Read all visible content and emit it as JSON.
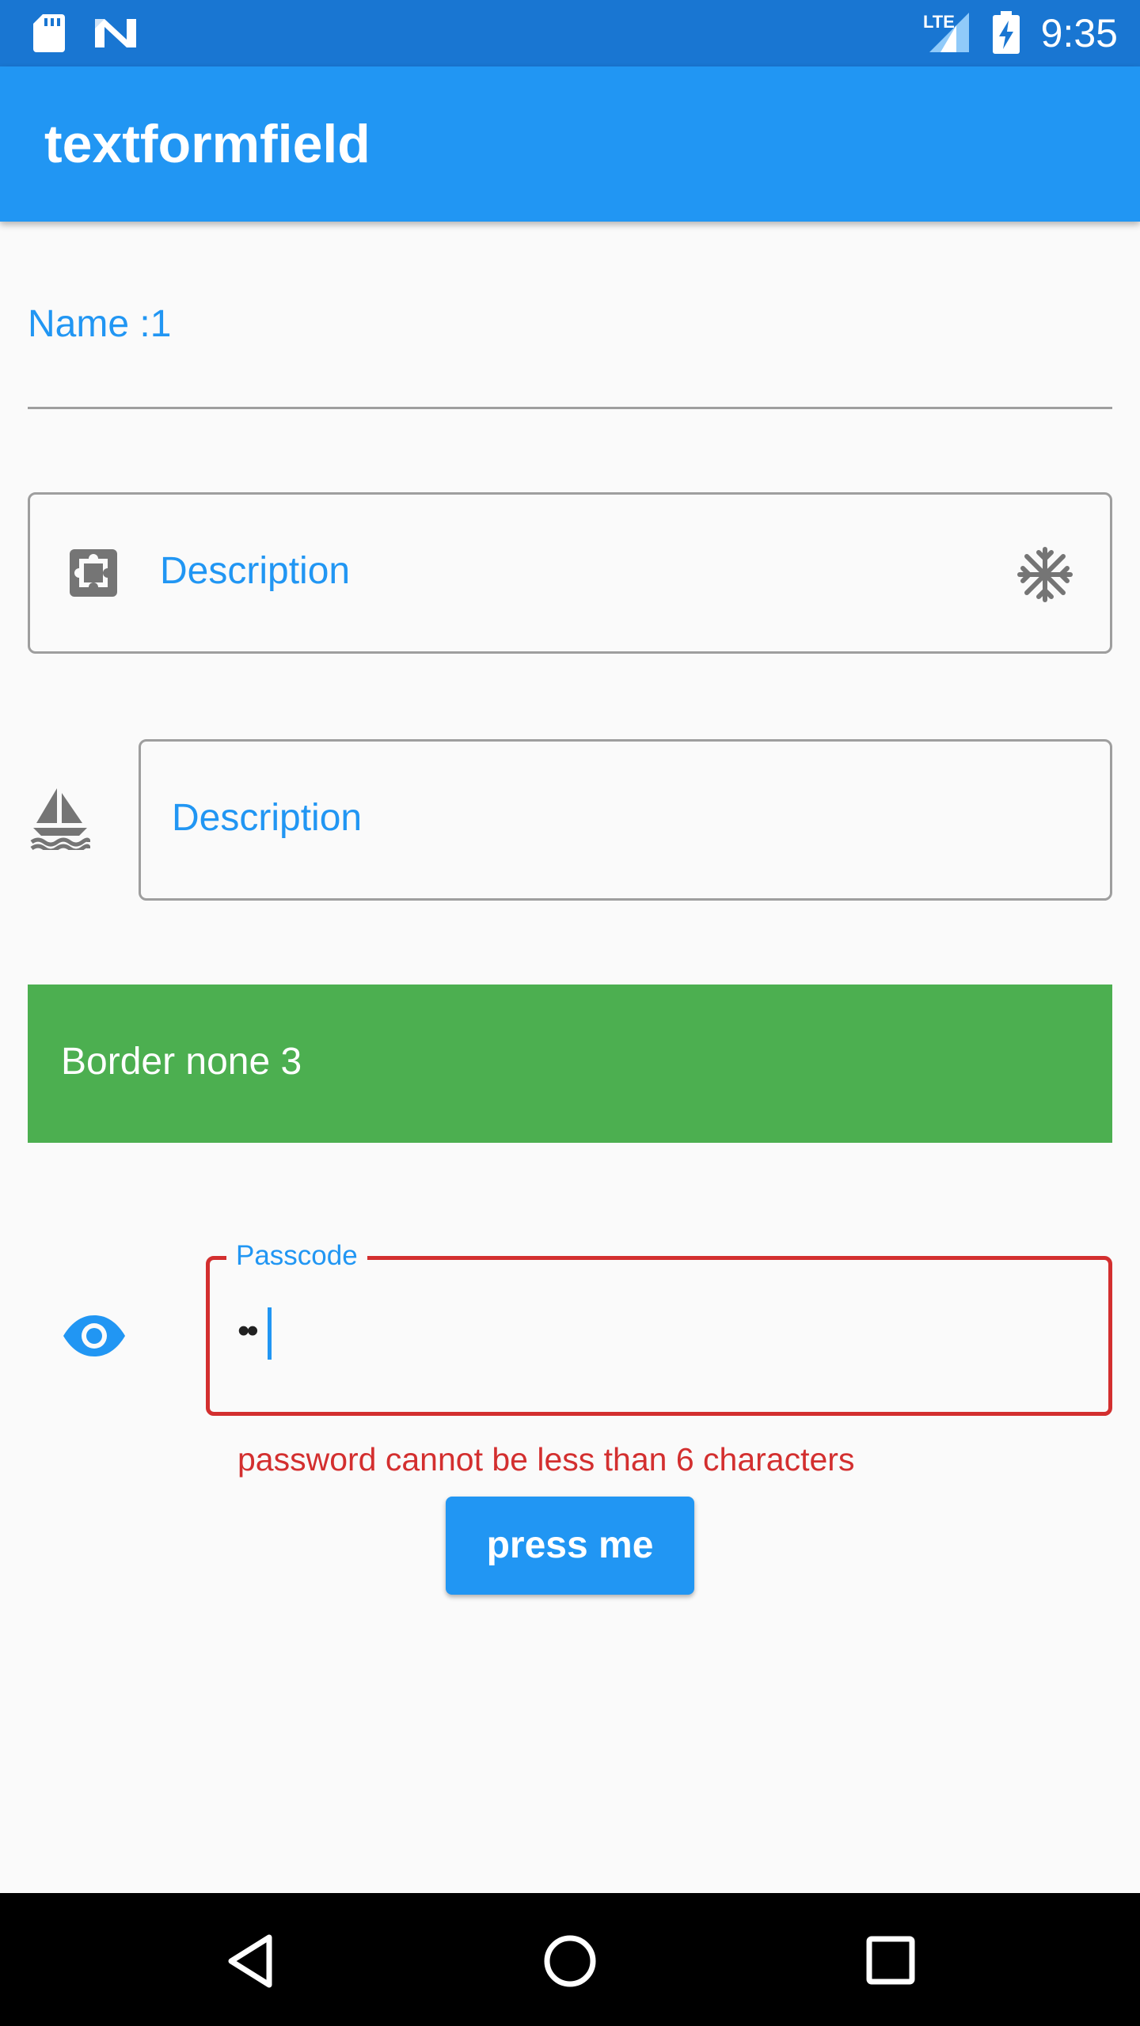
{
  "status_bar": {
    "time": "9:35",
    "network_label": "LTE",
    "icons": [
      "sd-card-icon",
      "notification-n-icon",
      "lte-signal-icon",
      "battery-charging-icon"
    ]
  },
  "app_bar": {
    "title": "textformfield"
  },
  "form": {
    "name_field": {
      "label": "Name :1"
    },
    "description_field_1": {
      "label": "Description",
      "prefix_icon": "puzzle-piece-icon",
      "suffix_icon": "snowflake-icon"
    },
    "description_field_2": {
      "label": "Description",
      "leading_icon": "sailboat-icon"
    },
    "border_none_field": {
      "label": "Border none 3",
      "fill_color": "#4caf50"
    },
    "passcode_field": {
      "label": "Passcode",
      "value_masked": "••",
      "leading_icon": "eye-icon",
      "error_text": "password cannot be less than 6 characters",
      "error_color": "#d32f2f"
    },
    "submit_button": {
      "label": "press me"
    }
  },
  "nav_bar": {
    "buttons": [
      "back-icon",
      "home-icon",
      "recents-icon"
    ]
  },
  "colors": {
    "primary": "#2196f3",
    "primary_dark": "#1976d2",
    "background": "#fafafa",
    "outline": "#9e9e9e"
  }
}
